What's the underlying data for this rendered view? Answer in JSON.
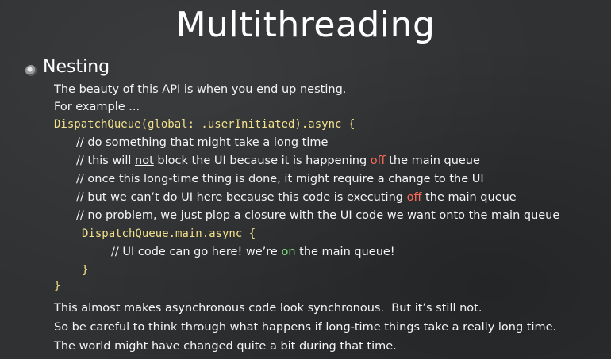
{
  "title": "Multithreading",
  "heading": "Nesting",
  "intro": {
    "line1": "The beauty of this API is when you end up nesting.",
    "line2": "For example ..."
  },
  "code": {
    "outer_open": "DispatchQueue(global: .userInitiated).async {",
    "c1": "// do something that might take a long time",
    "c2_a": "// this will ",
    "c2_not": "not",
    "c2_b": " block the UI because it is happening ",
    "c2_off": "off",
    "c2_c": " the main queue",
    "c3": "// once this long-time thing is done, it might require a change to the UI",
    "c4_a": "// but we can’t do UI here because this code is executing ",
    "c4_off": "off",
    "c4_b": " the main queue",
    "c5": "// no problem, we just plop a closure with the UI code we want onto the main queue",
    "inner_open": "DispatchQueue.main.async {",
    "inner_a": "// UI code can go here! we’re ",
    "inner_on": "on",
    "inner_b": " the main queue!",
    "inner_close": "}",
    "outer_close": "}"
  },
  "outro": {
    "line1": "This almost makes asynchronous code look synchronous.  But it’s still not.",
    "line2": "So be careful to think through what happens if long-time things take a really long time.",
    "line3": "The world might have changed quite a bit during that time."
  },
  "colors": {
    "background": "#2f3133",
    "code": "#f3e18c",
    "off_highlight": "#ff6a5a",
    "on_highlight": "#7fe07f"
  }
}
